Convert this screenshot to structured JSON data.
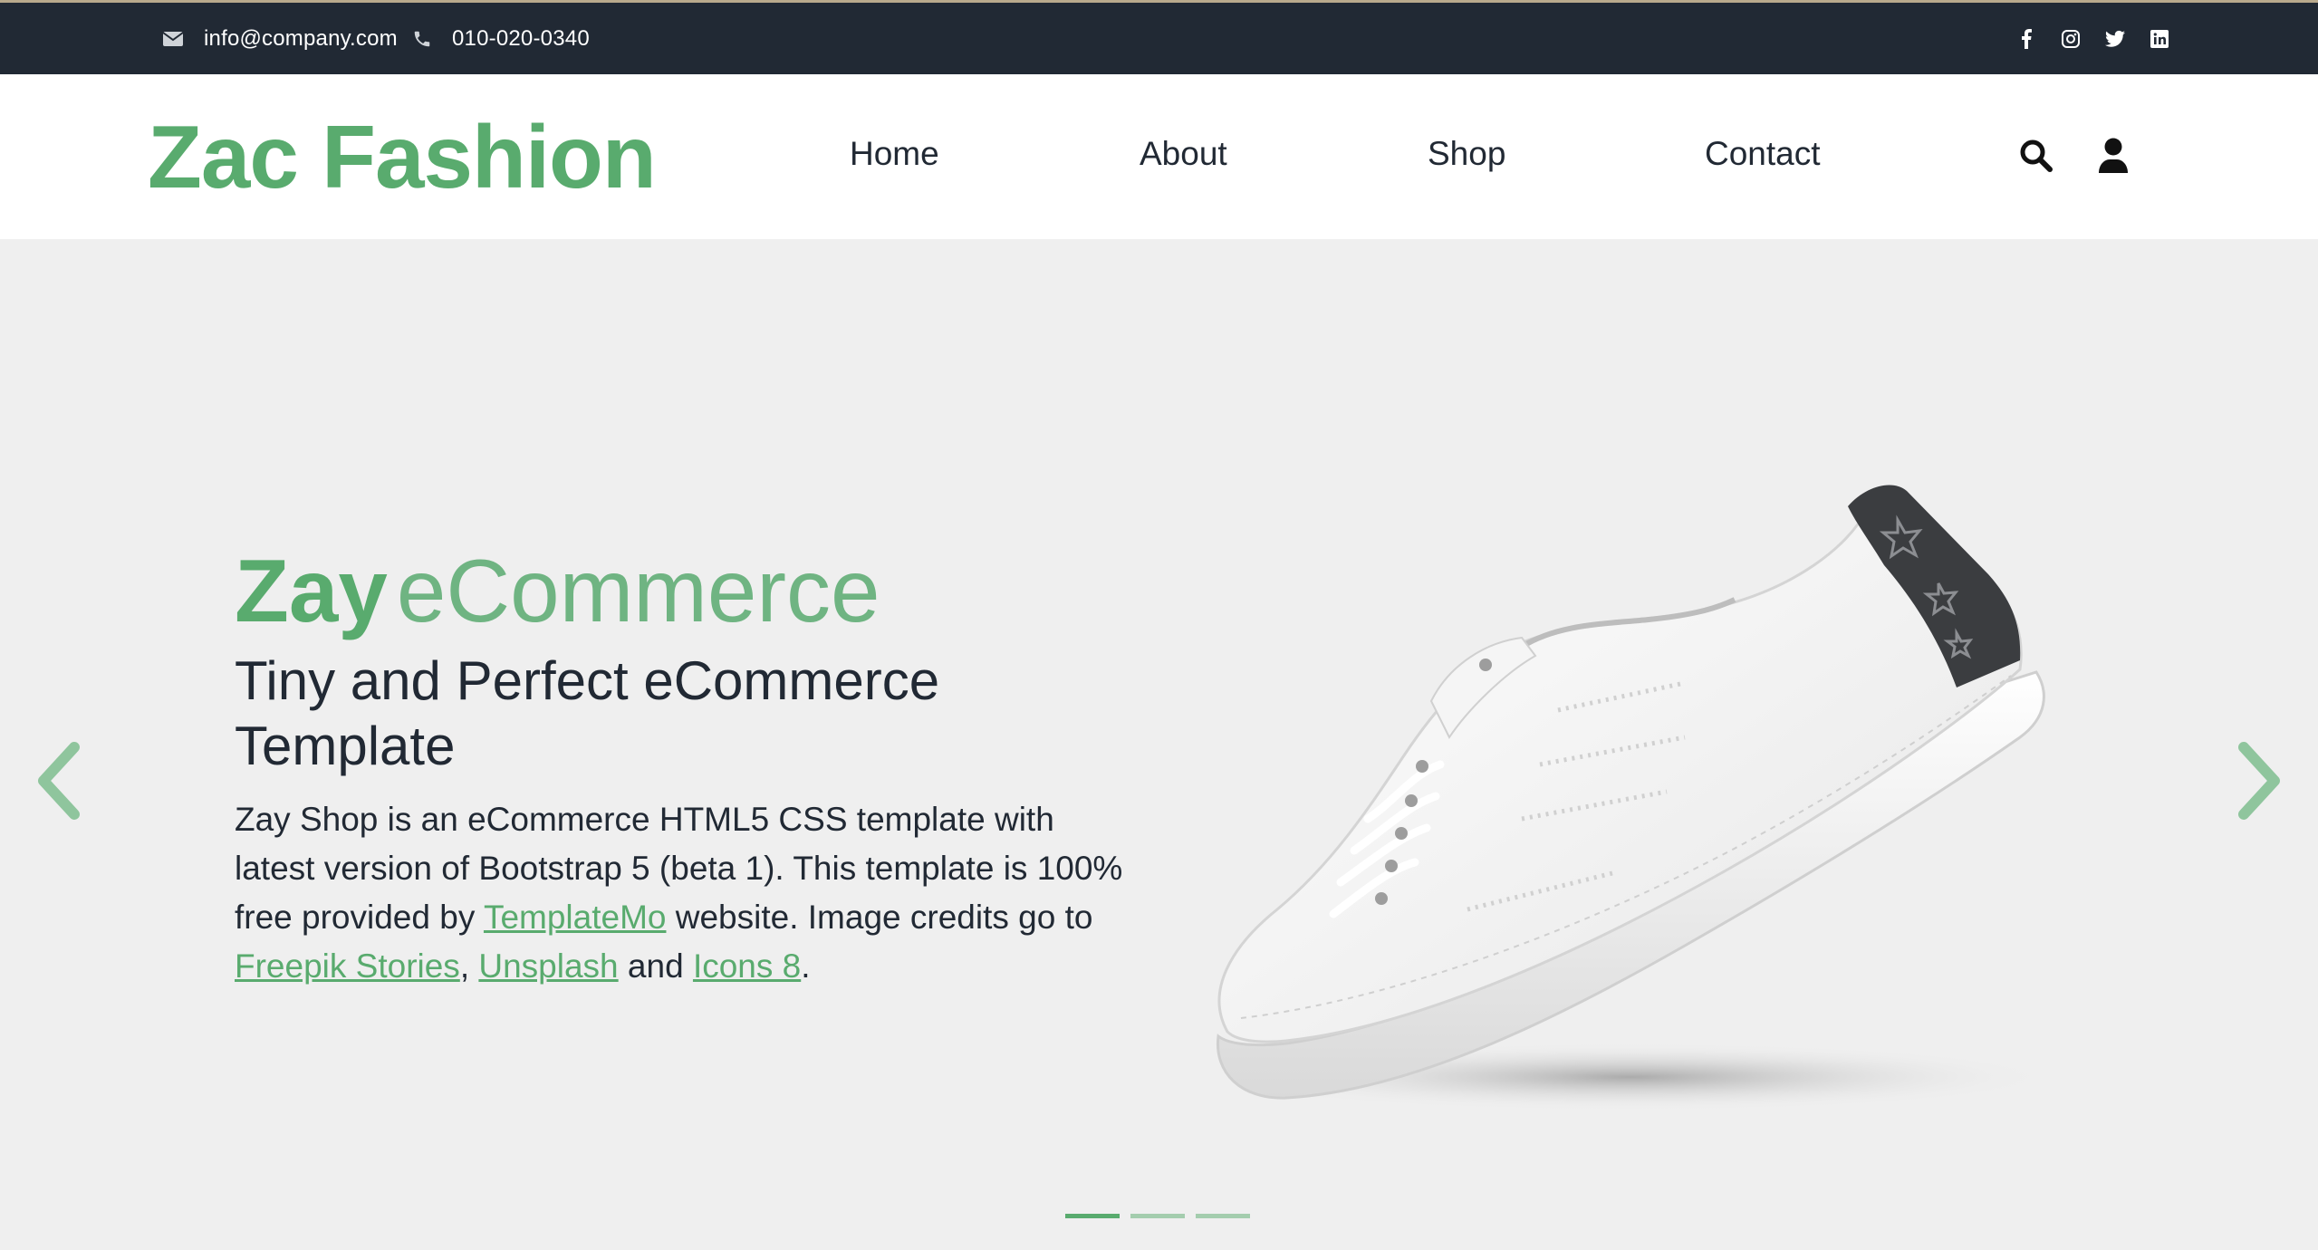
{
  "topbar": {
    "email": "info@company.com",
    "phone": "010-020-0340",
    "icons": [
      "envelope-icon",
      "phone-icon",
      "facebook-icon",
      "instagram-icon",
      "twitter-icon",
      "linkedin-icon"
    ]
  },
  "nav": {
    "brand": "Zac Fashion",
    "links": [
      "Home",
      "About",
      "Shop",
      "Contact"
    ],
    "icons": [
      "search-icon",
      "user-icon"
    ]
  },
  "hero": {
    "title_bold": "Zay",
    "title_light": "eCommerce",
    "subtitle": "Tiny and Perfect eCommerce Template",
    "desc_part1": "Zay Shop is an eCommerce HTML5 CSS template with latest version of Bootstrap 5 (beta 1). This template is 100% free provided by ",
    "link_templatemo": "TemplateMo",
    "desc_part2": " website. Image credits go to ",
    "link_freepik": "Freepik Stories",
    "desc_comma": ", ",
    "link_unsplash": "Unsplash",
    "desc_and": " and ",
    "link_icons8": "Icons 8",
    "desc_end": ".",
    "slide_count": 3,
    "active_slide": 1
  },
  "colors": {
    "brand_green": "#59ab6e",
    "dark": "#212934",
    "hero_bg": "#efefef"
  }
}
